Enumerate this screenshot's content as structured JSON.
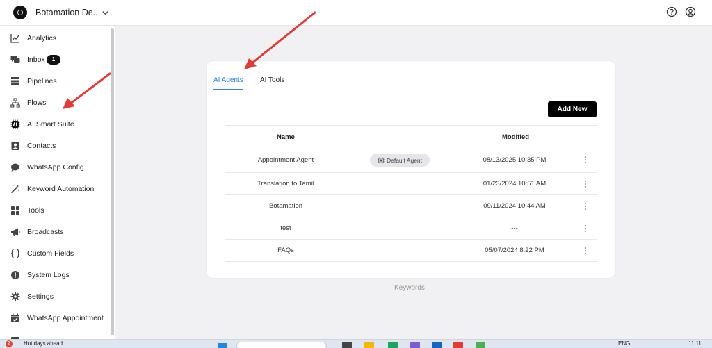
{
  "header": {
    "workspace_name": "Botamation De...",
    "icons": {
      "help": "help-circle-icon",
      "account": "user-circle-icon",
      "chevron": "chevron-down-icon"
    }
  },
  "sidebar": {
    "items": [
      {
        "label": "Analytics",
        "icon": "chart-line-icon"
      },
      {
        "label": "Inbox",
        "icon": "chat-bubbles-icon",
        "badge": "1"
      },
      {
        "label": "Pipelines",
        "icon": "server-stack-icon"
      },
      {
        "label": "Flows",
        "icon": "sitemap-icon"
      },
      {
        "label": "AI Smart Suite",
        "icon": "ai-chip-icon"
      },
      {
        "label": "Contacts",
        "icon": "contact-card-icon"
      },
      {
        "label": "WhatsApp Config",
        "icon": "speech-bubble-icon"
      },
      {
        "label": "Keyword Automation",
        "icon": "magic-wand-icon"
      },
      {
        "label": "Tools",
        "icon": "grid-icon"
      },
      {
        "label": "Broadcasts",
        "icon": "megaphone-icon"
      },
      {
        "label": "Custom Fields",
        "icon": "braces-icon"
      },
      {
        "label": "System Logs",
        "icon": "alert-circle-icon"
      },
      {
        "label": "Settings",
        "icon": "gear-icon"
      },
      {
        "label": "WhatsApp Appointment",
        "icon": "calendar-check-icon"
      }
    ]
  },
  "main": {
    "tabs": [
      {
        "label": "AI Agents",
        "active": true
      },
      {
        "label": "AI Tools",
        "active": false
      }
    ],
    "add_button_label": "Add New",
    "table": {
      "headers": {
        "name": "Name",
        "modified": "Modified"
      },
      "rows": [
        {
          "name": "Appointment Agent",
          "tag": "Default Agent",
          "modified": "08/13/2025 10:35 PM"
        },
        {
          "name": "Translation to Tamil",
          "modified": "01/23/2024 10:51 AM"
        },
        {
          "name": "Botamation",
          "modified": "09/11/2024 10:44 AM"
        },
        {
          "name": "test",
          "modified": "---"
        },
        {
          "name": "FAQs",
          "modified": "05/07/2024 8:22 PM"
        }
      ]
    },
    "footer_link": "Keywords"
  },
  "annotations": {
    "arrow_color": "#e53935"
  },
  "colors": {
    "accent": "#2f80ed",
    "button": "#000000",
    "badge": "#111111"
  },
  "taskbar": {
    "weather_badge": "2",
    "weather_text": "Hot days ahead",
    "language": "ENG",
    "time": "11:11"
  }
}
